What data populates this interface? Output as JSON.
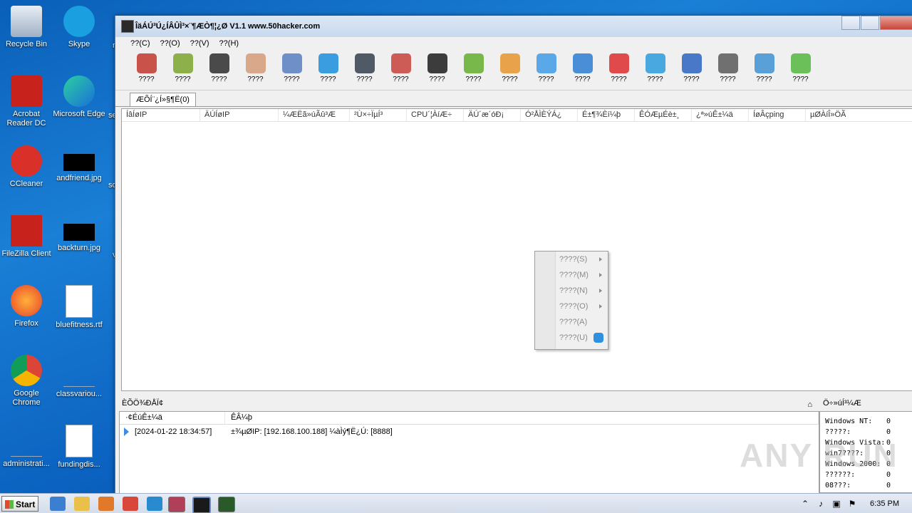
{
  "desktop": {
    "icons": [
      {
        "label": "Recycle Bin",
        "kind": "recycle-bin-icon"
      },
      {
        "label": "Skype",
        "kind": "skype-icon"
      },
      {
        "label": "Acrobat Reader DC",
        "kind": "acrobat-icon"
      },
      {
        "label": "Microsoft Edge",
        "kind": "edge-icon"
      },
      {
        "label": "CCleaner",
        "kind": "ccleaner-icon"
      },
      {
        "label": "andfriend.jpg",
        "kind": "image-file-icon"
      },
      {
        "label": "FileZilla Client",
        "kind": "filezilla-icon"
      },
      {
        "label": "backturn.jpg",
        "kind": "image-file-icon"
      },
      {
        "label": "Firefox",
        "kind": "firefox-icon"
      },
      {
        "label": "bluefitness.rtf",
        "kind": "word-doc-icon"
      },
      {
        "label": "Google Chrome",
        "kind": "chrome-icon"
      },
      {
        "label": "classvariou...",
        "kind": "blank-file-icon"
      },
      {
        "label": "administrati...",
        "kind": "blank-file-icon"
      },
      {
        "label": "fundingdis...",
        "kind": "word-doc-icon"
      }
    ],
    "peek": [
      "m",
      "ser",
      "sol",
      "v"
    ]
  },
  "window": {
    "title": "ÎäÁÚ³Ú¿ÍÂÛÌ³×¨¶ÆÒ¶¦¿Ø V1.1 www.50hacker.com",
    "menu": [
      "??(C)",
      "??(O)",
      "??(V)",
      "??(H)"
    ],
    "toolbar": [
      "????",
      "????",
      "????",
      "????",
      "????",
      "????",
      "????",
      "????",
      "????",
      "????",
      "????",
      "????",
      "????",
      "????",
      "????",
      "????",
      "????",
      "????",
      "????"
    ],
    "toolbar_colors": [
      "#c9524a",
      "#8db04a",
      "#4a4a4a",
      "#d9a88a",
      "#6f8fc9",
      "#3a9de0",
      "#505a66",
      "#cc5c55",
      "#3c3c3c",
      "#78b84a",
      "#e8a24a",
      "#5aa8e8",
      "#4a8ed8",
      "#e04a4a",
      "#4aa8e0",
      "#4a78c8",
      "#707070",
      "#5aa0d8",
      "#6cc05a"
    ],
    "tab_label": "ÆÕÍ¨¿Í»§¶Ë(0)",
    "columns": [
      "ÍâÍøIP",
      "ÄÚÍøIP",
      "¼ÆËã»úÃû³Æ",
      "²Ù×÷ÏµÍ³",
      "CPU´¦ÀíÆ÷",
      "ÄÚ´æ´óÐ¡",
      "Ó²ÅÌÈÝÁ¿",
      "É±¶¾Èí¼þ",
      "ÊÓÆµÉè±¸",
      "¿ª»úÊ±¼ä",
      "ÍøÂçping",
      "µØÀíÎ»ÖÃ"
    ]
  },
  "log": {
    "title": "ÈÕÖ¾ÐÅÏ¢",
    "pin": "⌂",
    "headers": [
      "·¢ÉúÊ±¼ä",
      "ÊÂ¼þ"
    ],
    "rows": [
      {
        "time": "[2024-01-22 18:34:57]",
        "event": "±¾µØIP: [192.168.100.188] ¼àÌý¶Ë¿Ú: [8888]"
      }
    ]
  },
  "stats": {
    "title": "Ö÷»úÍ³¼Æ",
    "rows": [
      {
        "label": "Windows NT:",
        "value": "0"
      },
      {
        "label": "?????:",
        "value": "0"
      },
      {
        "label": "Windows Vista:",
        "value": "0"
      },
      {
        "label": "win7????:",
        "value": "0"
      },
      {
        "label": "Windows 2000:",
        "value": "0"
      },
      {
        "label": "??????:",
        "value": "0"
      },
      {
        "label": "08???:",
        "value": "0"
      }
    ]
  },
  "context_menu": [
    {
      "label": "????(S)",
      "submenu": true
    },
    {
      "label": "????(M)",
      "submenu": true
    },
    {
      "label": "????(N)",
      "submenu": true
    },
    {
      "label": "????(O)",
      "submenu": true
    },
    {
      "label": "????(A)",
      "submenu": false
    },
    {
      "label": "????(U)",
      "submenu": false
    }
  ],
  "watermark": "ANY RUN",
  "taskbar": {
    "start": "Start",
    "clock": "6:35 PM"
  }
}
